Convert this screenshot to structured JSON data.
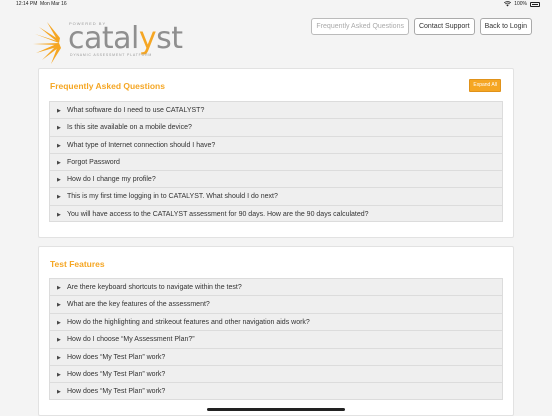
{
  "status": {
    "time": "12:14 PM",
    "date": "Mon Mar 16",
    "battery": "100%"
  },
  "logo": {
    "powered": "POWERED BY",
    "word_a": "catal",
    "word_y": "y",
    "word_b": "st",
    "tagline": "DYNAMIC ASSESSMENT PLATFORM"
  },
  "nav": {
    "faq": "Frequently Asked Questions",
    "contact": "Contact Support",
    "back": "Back to Login"
  },
  "faq_section": {
    "title": "Frequently Asked Questions",
    "expand_label": "Expand All",
    "items": [
      "What software do I need to use CATALYST?",
      "Is this site available on a mobile device?",
      "What type of Internet connection should I have?",
      "Forgot Password",
      "How do I change my profile?",
      "This is my first time logging in to CATALYST. What should I do next?",
      "You will have access to the CATALYST assessment for 90 days. How are the 90 days calculated?"
    ]
  },
  "test_section": {
    "title": "Test Features",
    "items": [
      "Are there keyboard shortcuts to navigate within the test?",
      "What are the key features of the assessment?",
      "How do the highlighting and strikeout features and other navigation aids work?",
      "How do I choose “My Assessment Plan?”",
      "How does “My Test Plan” work?",
      "How does “My Test Plan” work?",
      "How does “My Test Plan” work?"
    ]
  },
  "colors": {
    "accent": "#f5a623",
    "logo_gray": "#8f8f8f"
  },
  "icons": {
    "question_arrow": "triangle-right-icon",
    "logo_mark": "starburst-logo-icon"
  }
}
